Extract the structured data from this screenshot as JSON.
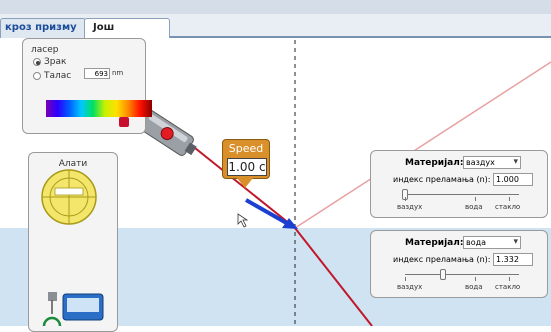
{
  "tabs": [
    {
      "label": "кроз призму"
    },
    {
      "label": "Још играчака"
    }
  ],
  "laser": {
    "title": "ласер",
    "options": [
      "Зрак",
      "Талас"
    ],
    "selected": "Зрак",
    "wavelength_value": "693",
    "wavelength_unit": "nm"
  },
  "tools": {
    "title": "Алати"
  },
  "speed_tool": {
    "label": "Speed",
    "value": "1.00 c"
  },
  "top_medium": {
    "material_label": "Материјал:",
    "material_value": "ваздух",
    "index_label": "индекс преламања (n):",
    "index_value": "1.000",
    "slider_level": 0.0,
    "slider_ticks": [
      "ваздух",
      "вода",
      "стакло"
    ]
  },
  "bottom_medium": {
    "material_label": "Материјал:",
    "material_value": "вода",
    "index_label": "индекс преламања (n):",
    "index_value": "1.332",
    "slider_level": 0.332,
    "slider_ticks": [
      "ваздух",
      "вода",
      "стакло"
    ]
  },
  "colors": {
    "incident_beam": "#c0182a",
    "reflected_beam": "#e8a0a0",
    "refracted_beam": "#c0182a",
    "water": "#cfe3f2",
    "speed_tool": "#d9902b",
    "spectrum_knob": "#c8102e"
  },
  "icons": [
    "laser-pointer-icon",
    "protractor-icon",
    "intensity-meter-icon",
    "mouse-cursor-icon"
  ]
}
